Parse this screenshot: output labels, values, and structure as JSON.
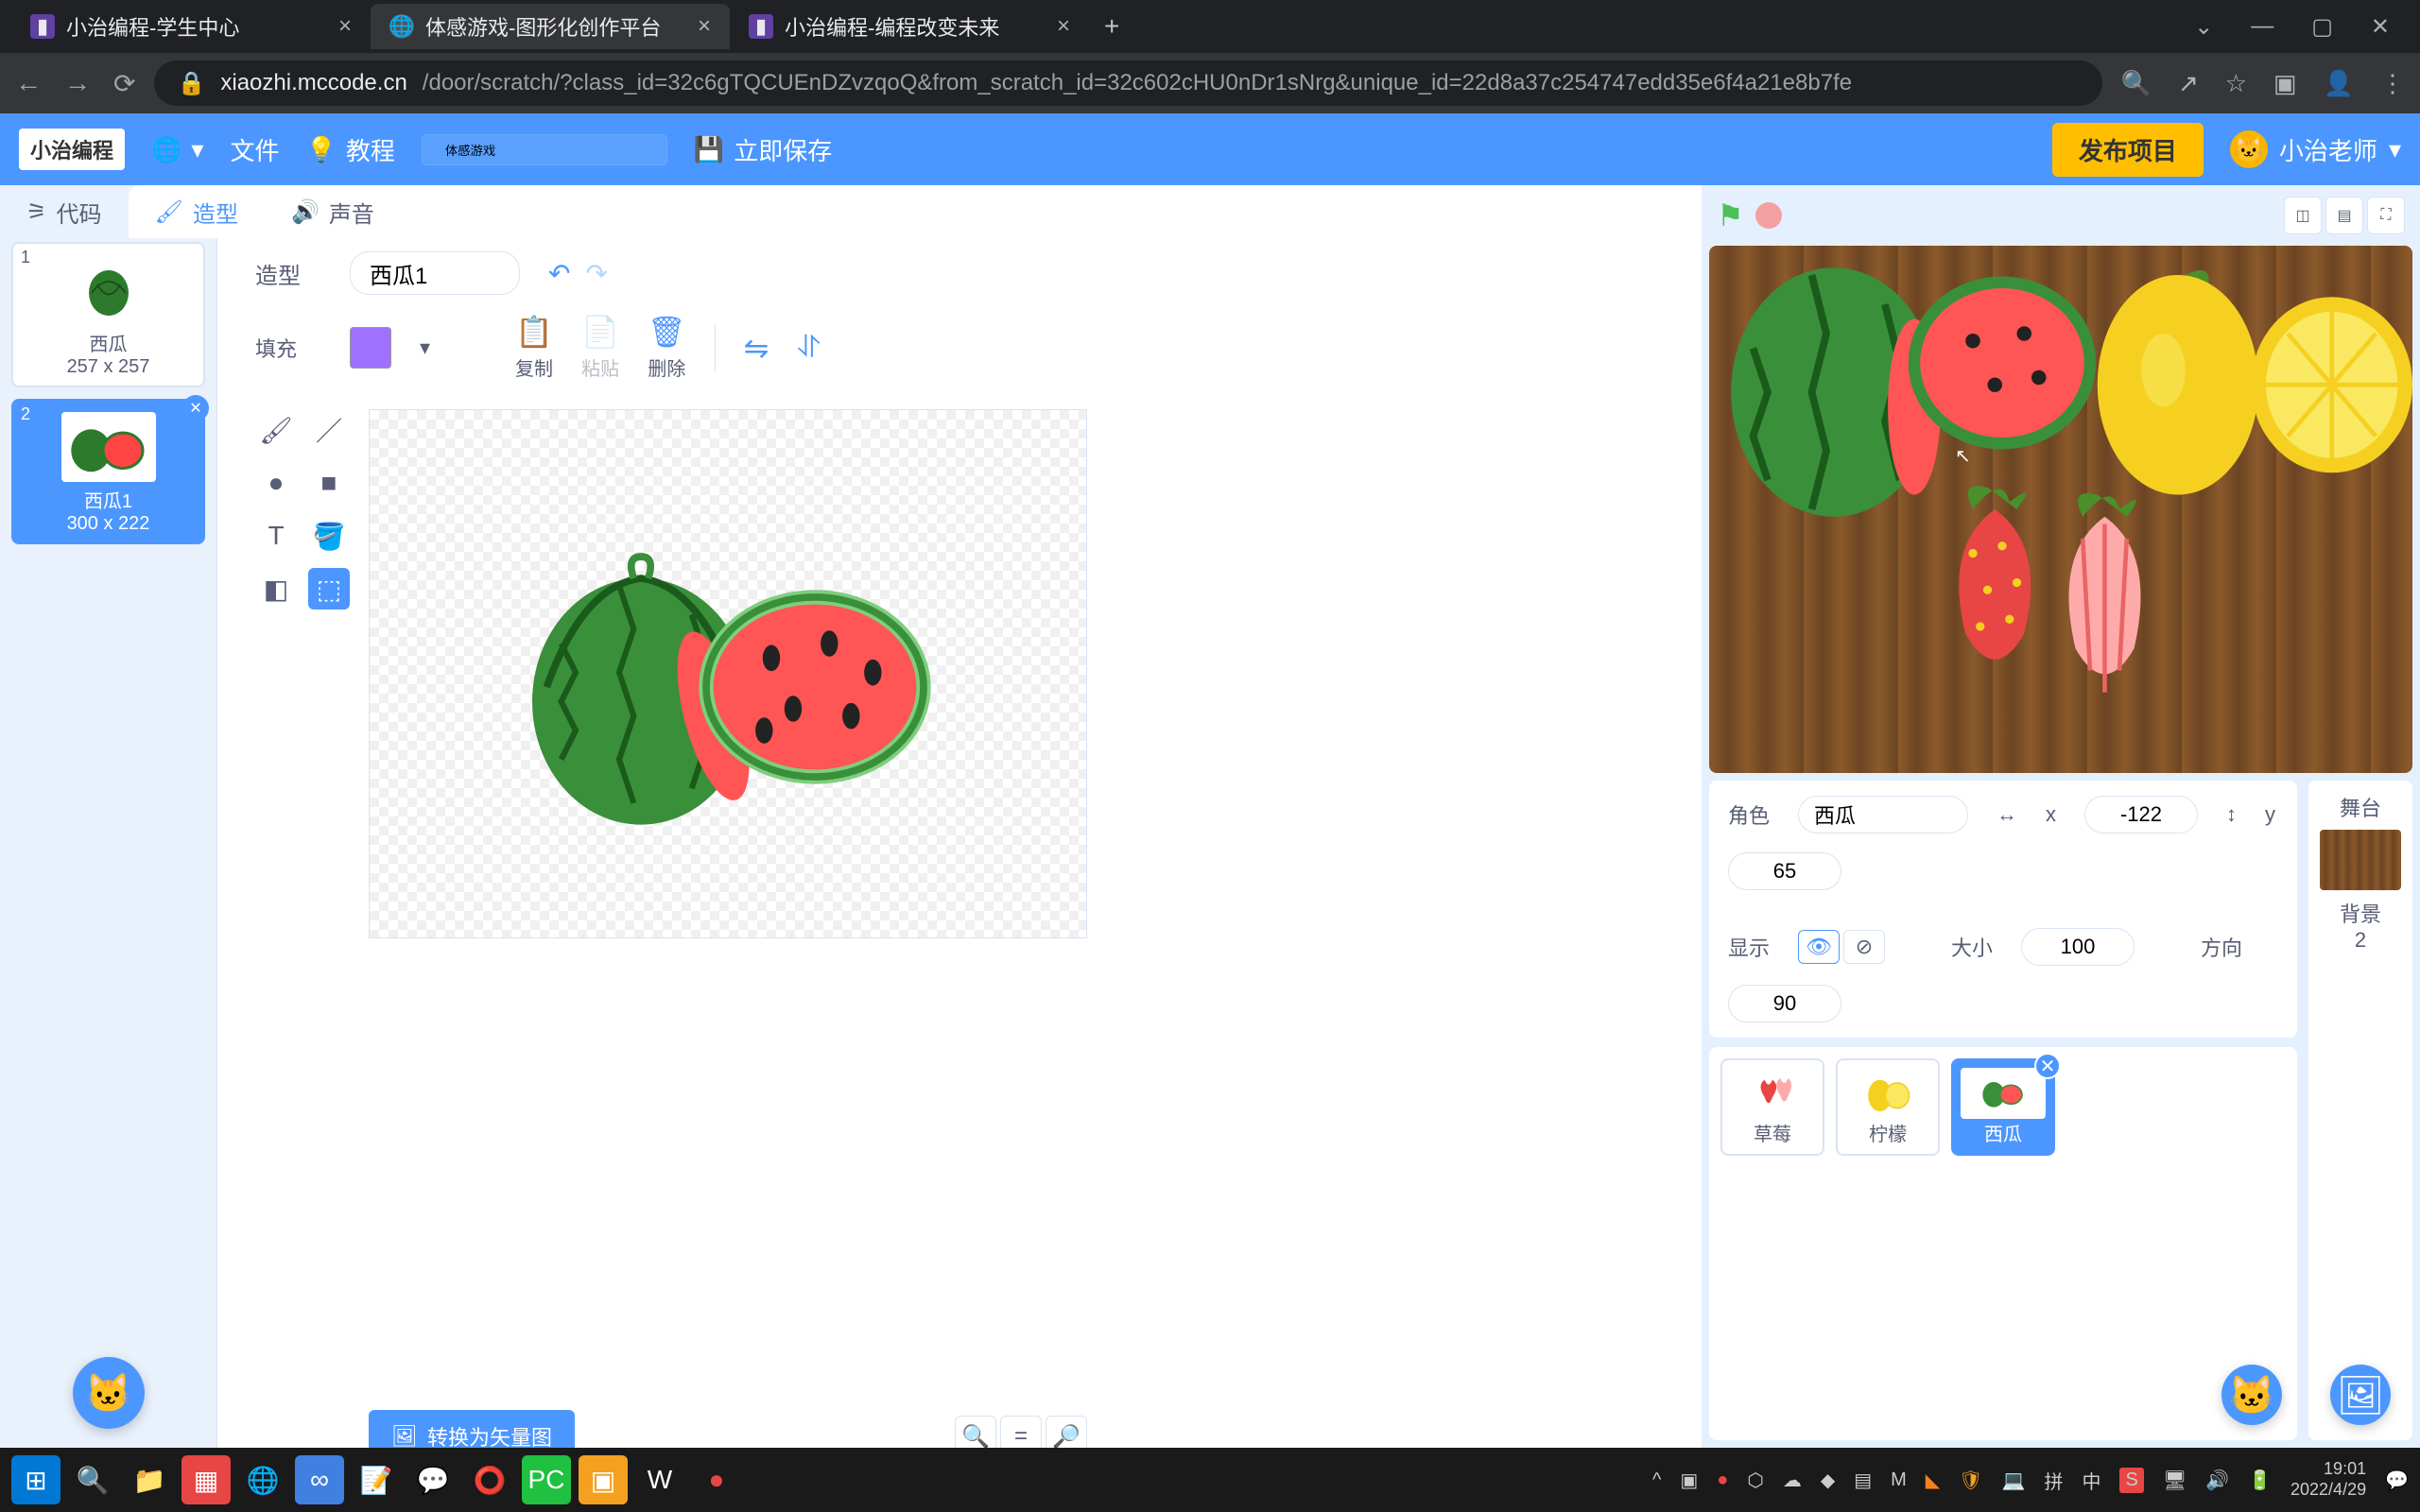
{
  "browser": {
    "tabs": [
      {
        "title": "小治编程-学生中心"
      },
      {
        "title": "体感游戏-图形化创作平台"
      },
      {
        "title": "小治编程-编程改变未来"
      }
    ],
    "url_prefix": "xiaozhi.mccode.cn",
    "url_path": "/door/scratch/?class_id=32c6gTQCUEnDZvzqoQ&from_scratch_id=32c602cHU0nDr1sNrg&unique_id=22d8a37c254747edd35e6f4a21e8b7fe"
  },
  "header": {
    "logo": "小治编程",
    "file": "文件",
    "tutorial": "教程",
    "project_name": "体感游戏",
    "save": "立即保存",
    "publish": "发布项目",
    "user": "小治老师"
  },
  "editor_tabs": {
    "code": "代码",
    "costume": "造型",
    "sound": "声音"
  },
  "costumes": [
    {
      "num": "1",
      "name": "西瓜",
      "size": "257 x 257"
    },
    {
      "num": "2",
      "name": "西瓜1",
      "size": "300 x 222"
    }
  ],
  "paint": {
    "costume_label": "造型",
    "costume_name": "西瓜1",
    "fill_label": "填充",
    "copy": "复制",
    "paste": "粘贴",
    "delete": "删除",
    "convert": "转换为矢量图"
  },
  "sprite_info": {
    "role_label": "角色",
    "role_name": "西瓜",
    "x_label": "x",
    "x_value": "-122",
    "y_label": "y",
    "y_value": "65",
    "show_label": "显示",
    "size_label": "大小",
    "size_value": "100",
    "direction_label": "方向",
    "direction_value": "90"
  },
  "sprites": [
    {
      "name": "草莓"
    },
    {
      "name": "柠檬"
    },
    {
      "name": "西瓜"
    }
  ],
  "stage_panel": {
    "title": "舞台",
    "bg_label": "背景",
    "bg_count": "2"
  },
  "taskbar": {
    "time": "19:01",
    "date": "2022/4/29",
    "ime": "中",
    "ime2": "拼"
  }
}
